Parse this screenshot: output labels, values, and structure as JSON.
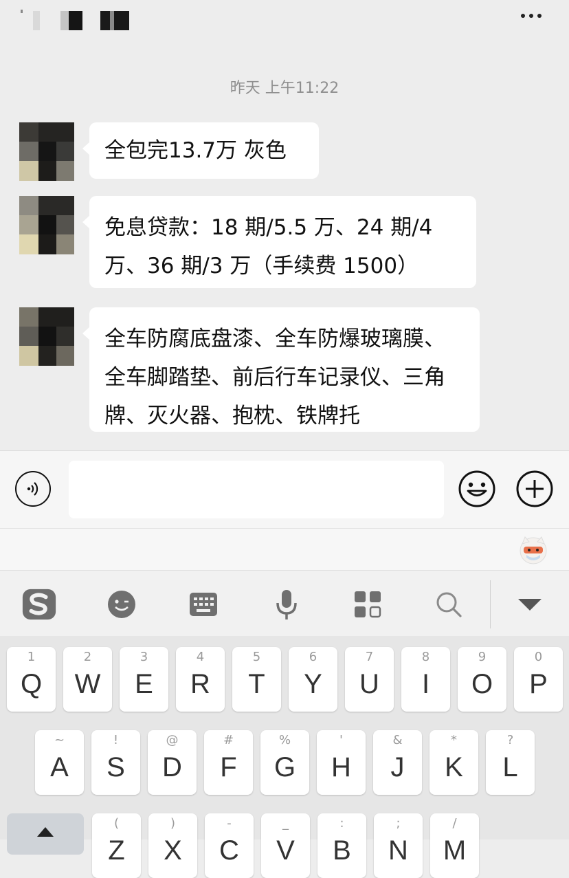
{
  "header": {
    "more_icon": "more-dots-icon"
  },
  "chat": {
    "timestamp": "昨天 上午11:22",
    "messages": [
      {
        "lines": [
          "全包完13.7万 灰色"
        ]
      },
      {
        "lines": [
          "免息贷款：18 期/5.5 万、24 期/4",
          "万、36 期/3 万（手续费 1500）"
        ]
      },
      {
        "lines": [
          "全车防腐底盘漆、全车防爆玻璃膜、",
          "全车脚踏垫、前后行车记录仪、三角",
          "牌、灭火器、抱枕、铁牌托"
        ]
      }
    ]
  },
  "input_bar": {
    "voice_icon": "voice-icon",
    "message_value": "",
    "emoji_icon": "emoji-icon",
    "plus_icon": "plus-icon"
  },
  "ime_toolbar": {
    "items": [
      "sogou-logo-icon",
      "face-icon",
      "keyboard-icon",
      "microphone-icon",
      "grid-apps-icon",
      "search-icon",
      "collapse-icon"
    ]
  },
  "keyboard": {
    "row1": [
      {
        "main": "Q",
        "sub": "1"
      },
      {
        "main": "W",
        "sub": "2"
      },
      {
        "main": "E",
        "sub": "3"
      },
      {
        "main": "R",
        "sub": "4"
      },
      {
        "main": "T",
        "sub": "5"
      },
      {
        "main": "Y",
        "sub": "6"
      },
      {
        "main": "U",
        "sub": "7"
      },
      {
        "main": "I",
        "sub": "8"
      },
      {
        "main": "O",
        "sub": "9"
      },
      {
        "main": "P",
        "sub": "0"
      }
    ],
    "row2": [
      {
        "main": "A",
        "sub": "~"
      },
      {
        "main": "S",
        "sub": "!"
      },
      {
        "main": "D",
        "sub": "@"
      },
      {
        "main": "F",
        "sub": "#"
      },
      {
        "main": "G",
        "sub": "%"
      },
      {
        "main": "H",
        "sub": "'"
      },
      {
        "main": "J",
        "sub": "&"
      },
      {
        "main": "K",
        "sub": "*"
      },
      {
        "main": "L",
        "sub": "?"
      }
    ],
    "row3": [
      {
        "main": "Z",
        "sub": "("
      },
      {
        "main": "X",
        "sub": ")"
      },
      {
        "main": "C",
        "sub": "-"
      },
      {
        "main": "V",
        "sub": "_"
      },
      {
        "main": "B",
        "sub": ":"
      },
      {
        "main": "N",
        "sub": ";"
      },
      {
        "main": "M",
        "sub": "/"
      }
    ]
  },
  "colors": {
    "background": "#ededed",
    "bubble": "#ffffff",
    "timestamp": "#8f8f8f"
  }
}
